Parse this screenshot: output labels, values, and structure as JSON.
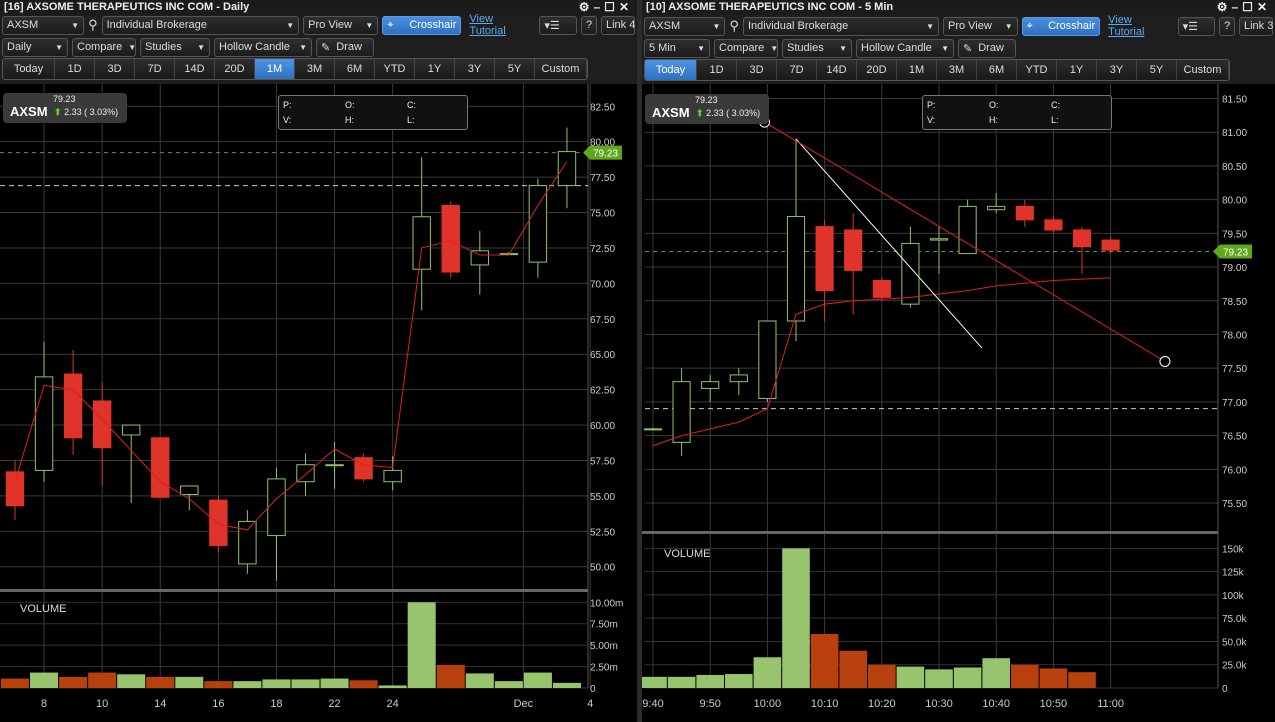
{
  "panels": [
    {
      "title": "[16] AXSOME THERAPEUTICS INC COM - Daily",
      "symbol": "AXSM",
      "account": "Individual Brokerage",
      "view": "Pro View",
      "crosshair": "Crosshair",
      "tutorial": "View Tutorial",
      "help": "?",
      "link": "Link 4",
      "interval": "Daily",
      "compare": "Compare",
      "studies": "Studies",
      "chart_type": "Hollow Candle",
      "draw": "Draw",
      "ranges": [
        "Today",
        "1D",
        "3D",
        "7D",
        "14D",
        "20D",
        "1M",
        "3M",
        "6M",
        "YTD",
        "1Y",
        "3Y",
        "5Y",
        "Custom"
      ],
      "active_range": "1M",
      "quote": {
        "symbol": "AXSM",
        "price": "79.23",
        "change": "2.33 ( 3.03%)"
      },
      "ohlc_labels": [
        "P:",
        "O:",
        "C:",
        "V:",
        "H:",
        "L:"
      ],
      "last_tag": "79.23",
      "volume_label": "VOLUME"
    },
    {
      "title": "[10] AXSOME THERAPEUTICS INC COM - 5 Min",
      "symbol": "AXSM",
      "account": "Individual Brokerage",
      "view": "Pro View",
      "crosshair": "Crosshair",
      "tutorial": "View Tutorial",
      "help": "?",
      "link": "Link 3",
      "interval": "5 Min",
      "compare": "Compare",
      "studies": "Studies",
      "chart_type": "Hollow Candle",
      "draw": "Draw",
      "ranges": [
        "Today",
        "1D",
        "3D",
        "7D",
        "14D",
        "20D",
        "1M",
        "3M",
        "6M",
        "YTD",
        "1Y",
        "3Y",
        "5Y",
        "Custom"
      ],
      "active_range": "Today",
      "quote": {
        "symbol": "AXSM",
        "price": "79.23",
        "change": "2.33 ( 3.03%)"
      },
      "ohlc_labels": [
        "P:",
        "O:",
        "C:",
        "V:",
        "H:",
        "L:"
      ],
      "last_tag": "79.23",
      "volume_label": "VOLUME"
    }
  ],
  "colors": {
    "up": "#8fc46a",
    "down": "#e0342a",
    "ma": "#e0201a",
    "tag": "#5fa81c",
    "vol_up": "#98c46e",
    "vol_down": "#b8400c"
  },
  "chart_data": [
    {
      "type": "candlestick",
      "title": "AXSM Daily",
      "last": 79.23,
      "prev_close": 76.9,
      "ylim": [
        48.5,
        84
      ],
      "yticks": [
        "82.50",
        "80.00",
        "77.50",
        "75.00",
        "72.50",
        "70.00",
        "67.50",
        "65.00",
        "62.50",
        "60.00",
        "57.50",
        "55.00",
        "52.50",
        "50.00"
      ],
      "xticks": [
        {
          "i": 1,
          "label": "8"
        },
        {
          "i": 3,
          "label": "10"
        },
        {
          "i": 5,
          "label": "14"
        },
        {
          "i": 7,
          "label": "16"
        },
        {
          "i": 9,
          "label": "18"
        },
        {
          "i": 11,
          "label": "22"
        },
        {
          "i": 13,
          "label": "24"
        },
        {
          "i": 17.5,
          "label": "Dec"
        },
        {
          "i": 19.8,
          "label": "4"
        }
      ],
      "candles": [
        [
          56.7,
          57.5,
          53.3,
          54.3
        ],
        [
          56.8,
          65.9,
          56.0,
          63.4
        ],
        [
          63.6,
          65.3,
          57.9,
          59.1
        ],
        [
          61.7,
          63.0,
          55.7,
          58.4
        ],
        [
          59.3,
          60.0,
          54.5,
          60.0
        ],
        [
          59.1,
          59.1,
          54.9,
          54.9
        ],
        [
          55.1,
          55.7,
          54.0,
          55.7
        ],
        [
          54.7,
          55.0,
          51.0,
          51.5
        ],
        [
          50.2,
          54.0,
          49.5,
          53.2
        ],
        [
          52.2,
          57.0,
          49.0,
          56.2
        ],
        [
          56.0,
          58.0,
          55.0,
          57.2
        ],
        [
          57.2,
          58.8,
          55.5,
          57.2
        ],
        [
          57.7,
          58.0,
          56.0,
          56.2
        ],
        [
          56.0,
          57.8,
          55.4,
          56.8
        ],
        [
          71.0,
          78.9,
          68.1,
          74.7
        ],
        [
          75.5,
          75.8,
          70.4,
          70.8
        ],
        [
          71.3,
          73.7,
          69.2,
          72.3
        ],
        [
          72.1,
          72.2,
          72.0,
          72.1
        ],
        [
          71.5,
          77.4,
          70.4,
          76.9
        ],
        [
          76.9,
          81.0,
          75.3,
          79.3
        ]
      ],
      "ma": [
        56.0,
        62.8,
        62.5,
        60.4,
        58.2,
        56.0,
        54.8,
        53.0,
        52.6,
        54.8,
        56.5,
        58.3,
        57.2,
        57.0,
        72.5,
        73.0,
        72.0,
        72.0,
        75.5,
        78.6
      ],
      "volume_ticks": [
        "10.00m",
        "7.50m",
        "5.00m",
        "2.50m",
        "0"
      ],
      "volume_max": 10.5,
      "volume": [
        1.1,
        1.8,
        1.3,
        1.8,
        1.6,
        1.3,
        1.3,
        0.8,
        0.8,
        1.0,
        1.0,
        1.1,
        0.9,
        0.3,
        10.0,
        2.7,
        1.7,
        0.8,
        1.8,
        0.6
      ]
    },
    {
      "type": "candlestick",
      "title": "AXSM 5 Min",
      "last": 79.23,
      "prev_close": 76.9,
      "ylim": [
        75.1,
        81.7
      ],
      "yticks": [
        "81.50",
        "81.00",
        "80.50",
        "80.00",
        "79.50",
        "79.00",
        "78.50",
        "78.00",
        "77.50",
        "77.00",
        "76.50",
        "76.00",
        "75.50"
      ],
      "xticks": [
        {
          "i": 0,
          "label": "9:40"
        },
        {
          "i": 2,
          "label": "9:50"
        },
        {
          "i": 4,
          "label": "10:00"
        },
        {
          "i": 6,
          "label": "10:10"
        },
        {
          "i": 8,
          "label": "10:20"
        },
        {
          "i": 10,
          "label": "10:30"
        },
        {
          "i": 12,
          "label": "10:40"
        },
        {
          "i": 14,
          "label": "10:50"
        },
        {
          "i": 16,
          "label": "11:00"
        }
      ],
      "candles": [
        [
          76.6,
          76.62,
          76.58,
          76.6
        ],
        [
          76.4,
          77.5,
          76.2,
          77.3
        ],
        [
          77.2,
          77.4,
          77.0,
          77.3
        ],
        [
          77.3,
          77.5,
          77.1,
          77.4
        ],
        [
          77.05,
          78.2,
          77.0,
          78.2
        ],
        [
          78.2,
          80.9,
          77.9,
          79.75
        ],
        [
          79.6,
          79.7,
          78.2,
          78.65
        ],
        [
          79.55,
          79.8,
          78.3,
          78.95
        ],
        [
          78.8,
          78.85,
          78.5,
          78.55
        ],
        [
          78.45,
          79.6,
          78.4,
          79.35
        ],
        [
          79.4,
          79.6,
          78.9,
          79.42
        ],
        [
          79.2,
          80.0,
          79.2,
          79.9
        ],
        [
          79.85,
          80.1,
          79.8,
          79.9
        ],
        [
          79.9,
          80.0,
          79.6,
          79.7
        ],
        [
          79.7,
          79.75,
          79.5,
          79.55
        ],
        [
          79.55,
          79.6,
          78.9,
          79.3
        ],
        [
          79.4,
          79.45,
          79.2,
          79.25
        ]
      ],
      "ma": [
        76.35,
        76.5,
        76.6,
        76.7,
        76.9,
        78.3,
        78.45,
        78.5,
        78.52,
        78.55,
        78.6,
        78.65,
        78.72,
        78.76,
        78.8,
        78.82,
        78.84
      ],
      "trendlines": [
        {
          "from": [
            5,
            80.9
          ],
          "to": [
            11.5,
            77.8
          ],
          "color": "#ffffff"
        },
        {
          "from": [
            3.9,
            81.15
          ],
          "to": [
            17.9,
            77.6
          ],
          "color": "#e0201a",
          "handles": true
        }
      ],
      "volume_ticks": [
        "150k",
        "125k",
        "100k",
        "75.0k",
        "50.0k",
        "25.0k",
        "0"
      ],
      "volume_max": 160,
      "volume": [
        12,
        12,
        14,
        15,
        33,
        150,
        58,
        40,
        25,
        23,
        20,
        22,
        32,
        25,
        21,
        17,
        0
      ]
    }
  ]
}
